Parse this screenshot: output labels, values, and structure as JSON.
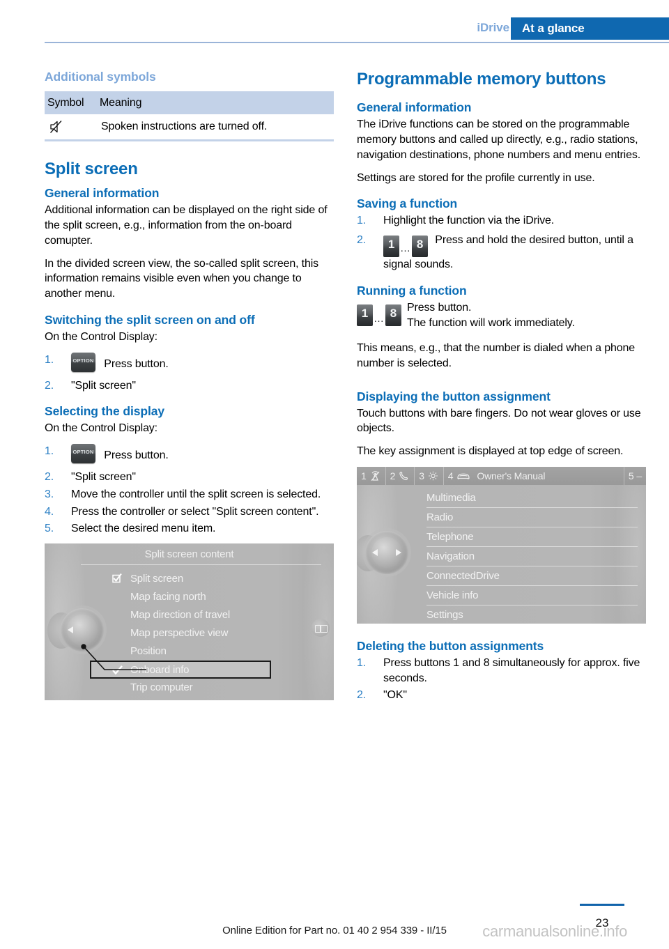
{
  "header": {
    "section": "iDrive",
    "banner": "At a glance",
    "banner_color": "#0f68b0",
    "section_color": "#7da7d9"
  },
  "left_column": {
    "symbols": {
      "heading": "Additional symbols",
      "columns": [
        "Symbol",
        "Meaning"
      ],
      "rows": [
        {
          "icon": "mute-speaker-icon",
          "meaning": "Spoken instructions are turned off."
        }
      ]
    },
    "split_screen": {
      "title": "Split screen",
      "general": {
        "heading": "General information",
        "paragraphs": [
          "Additional information can be displayed on the right side of the split screen, e.g., information from the on-board comupter.",
          "In the divided screen view, the so-called split screen, this information remains visible even when you change to another menu."
        ]
      },
      "switching": {
        "heading": "Switching the split screen on and off",
        "intro": "On the Control Display:",
        "steps": [
          {
            "num": "1.",
            "button": "OPTION",
            "text": "Press button."
          },
          {
            "num": "2.",
            "text": "\"Split screen\""
          }
        ]
      },
      "selecting": {
        "heading": "Selecting the display",
        "intro": "On the Control Display:",
        "steps": [
          {
            "num": "1.",
            "button": "OPTION",
            "text": "Press button."
          },
          {
            "num": "2.",
            "text": "\"Split screen\""
          },
          {
            "num": "3.",
            "text": "Move the controller until the split screen is selected."
          },
          {
            "num": "4.",
            "text": "Press the controller or select \"Split screen content\"."
          },
          {
            "num": "5.",
            "text": "Select the desired menu item."
          }
        ]
      }
    },
    "screenshot": {
      "title": "Split screen content",
      "items": [
        {
          "label": "Split screen",
          "mark": "checkbox",
          "highlight": false
        },
        {
          "label": "Map facing north",
          "mark": "",
          "highlight": false
        },
        {
          "label": "Map direction of travel",
          "mark": "",
          "highlight": false
        },
        {
          "label": "Map perspective view",
          "mark": "",
          "highlight": false
        },
        {
          "label": "Position",
          "mark": "",
          "highlight": false
        },
        {
          "label": "Onboard info",
          "mark": "check",
          "highlight": true
        },
        {
          "label": "Trip computer",
          "mark": "",
          "highlight": false
        }
      ]
    }
  },
  "right_column": {
    "title": "Programmable memory buttons",
    "general": {
      "heading": "General information",
      "paragraphs": [
        "The iDrive functions can be stored on the programmable memory buttons and called up directly, e.g., radio stations, navigation destinations, phone numbers and menu entries.",
        "Settings are stored for the profile currently in use."
      ]
    },
    "saving": {
      "heading": "Saving a function",
      "steps": [
        {
          "num": "1.",
          "text": "Highlight the function via the iDrive."
        },
        {
          "num": "2.",
          "buttons": [
            "1",
            "8"
          ],
          "dots": "…",
          "text": "Press and hold the desired button, until a signal sounds."
        }
      ]
    },
    "running": {
      "heading": "Running a function",
      "buttons": [
        "1",
        "8"
      ],
      "dots": "…",
      "line1": "Press button.",
      "line2": "The function will work immediately.",
      "paragraph": "This means, e.g., that the number is dialed when a phone number is selected."
    },
    "displaying": {
      "heading": "Displaying the button assignment",
      "paragraphs": [
        "Touch buttons with bare fingers. Do not wear gloves or use objects.",
        "The key assignment is displayed at top edge of screen."
      ]
    },
    "screenshot": {
      "topbar": [
        {
          "num": "1",
          "icon": "broadcast-icon"
        },
        {
          "num": "2",
          "icon": "telephone-icon"
        },
        {
          "num": "3",
          "icon": "gear-icon"
        },
        {
          "num": "4",
          "icon": "car-icon",
          "label": "Owner's Manual"
        },
        {
          "num": "5",
          "label": "–"
        }
      ],
      "items": [
        {
          "label": "Multimedia"
        },
        {
          "label": "Radio"
        },
        {
          "label": "Telephone"
        },
        {
          "label": "Navigation"
        },
        {
          "label": "ConnectedDrive"
        },
        {
          "label": "Vehicle info"
        },
        {
          "label": "Settings"
        }
      ]
    },
    "deleting": {
      "heading": "Deleting the button assignments",
      "steps": [
        {
          "num": "1.",
          "text": "Press buttons 1 and 8 simultaneously for approx. five seconds."
        },
        {
          "num": "2.",
          "text": "\"OK\""
        }
      ]
    }
  },
  "footer": {
    "online_edition": "Online Edition for Part no. 01 40 2 954 339 - II/15",
    "page_number": "23",
    "watermark": "carmanualsonline.info"
  }
}
